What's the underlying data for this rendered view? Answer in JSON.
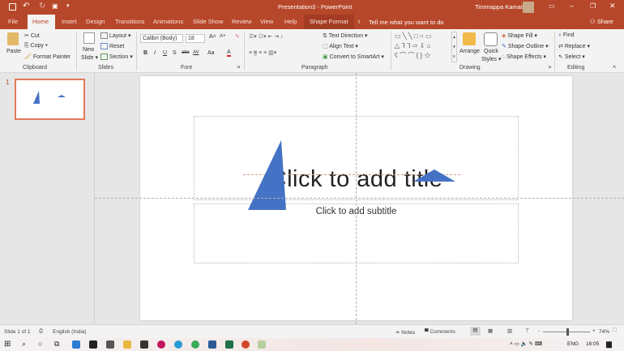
{
  "window": {
    "title": "Presentation3 - PowerPoint",
    "user": "Timmappa Kamat",
    "accent": "#b7472a"
  },
  "tabs": [
    "File",
    "Home",
    "Insert",
    "Design",
    "Transitions",
    "Animations",
    "Slide Show",
    "Review",
    "View",
    "Help",
    "Shape Format"
  ],
  "tell_me": "Tell me what you want to do",
  "share": "Share",
  "ribbon": {
    "clipboard": {
      "label": "Clipboard",
      "paste": "Paste",
      "cut": "Cut",
      "copy": "Copy",
      "format_painter": "Format Painter"
    },
    "slides": {
      "label": "Slides",
      "new_slide": "New",
      "new_slide2": "Slide",
      "layout": "Layout",
      "reset": "Reset",
      "section": "Section"
    },
    "font": {
      "label": "Font",
      "font_name": "Calibri (Body)",
      "font_size": "18",
      "bold": "B",
      "italic": "I",
      "underline": "U",
      "shadow": "S",
      "strike": "abc",
      "spacing": "AV",
      "case": "Aa",
      "color": "A"
    },
    "paragraph": {
      "label": "Paragraph",
      "text_direction": "Text Direction",
      "align_text": "Align Text",
      "convert_smartart": "Convert to SmartArt"
    },
    "drawing": {
      "label": "Drawing",
      "arrange": "Arrange",
      "quick_styles": "Quick",
      "quick_styles2": "Styles",
      "shape_fill": "Shape Fill",
      "shape_outline": "Shape Outline",
      "shape_effects": "Shape Effects"
    },
    "editing": {
      "label": "Editing",
      "find": "Find",
      "replace": "Replace",
      "select": "Select"
    }
  },
  "thumbnail": {
    "number": "1"
  },
  "slide": {
    "title_placeholder": "Click to add title",
    "subtitle_placeholder": "Click to add subtitle",
    "shape_color": "#4472c4"
  },
  "status": {
    "slide_count": "Slide 1 of 1",
    "language": "English (India)",
    "notes": "Notes",
    "comments": "Comments",
    "zoom": "74%",
    "zoom_fraction": 0.5
  },
  "taskbar": {
    "lang": "ENG",
    "time": "16:05"
  }
}
